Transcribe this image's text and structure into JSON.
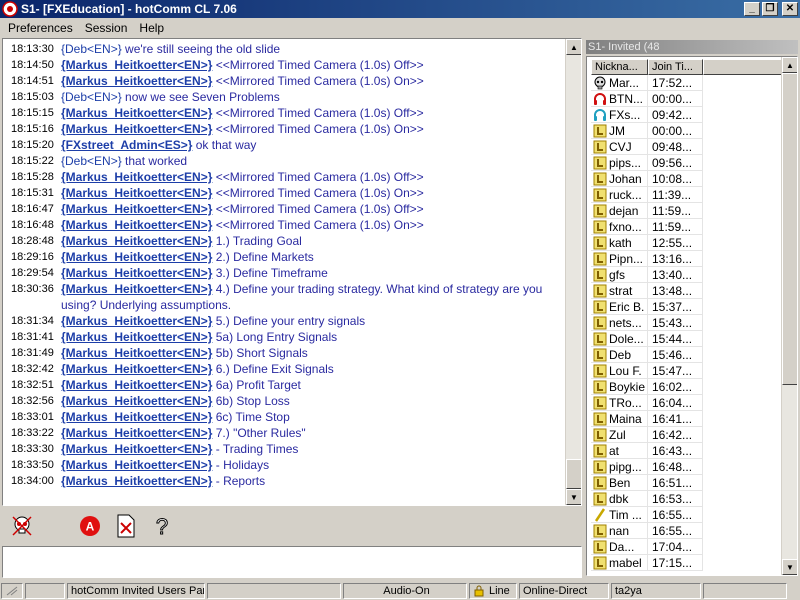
{
  "window": {
    "title": "S1- [FXEducation] - hotComm CL 7.06"
  },
  "menu": [
    "Preferences",
    "Session",
    "Help"
  ],
  "chat": [
    {
      "time": "18:13:30",
      "nick": "{Deb<EN>}",
      "bold": false,
      "msg": " we're still seeing the old slide"
    },
    {
      "time": "18:14:50",
      "nick": "{Markus_Heitkoetter<EN>}",
      "bold": true,
      "msg": " <<Mirrored Timed Camera (1.0s) Off>>"
    },
    {
      "time": "18:14:51",
      "nick": "{Markus_Heitkoetter<EN>}",
      "bold": true,
      "msg": " <<Mirrored Timed Camera (1.0s) On>>"
    },
    {
      "time": "18:15:03",
      "nick": "{Deb<EN>}",
      "bold": false,
      "msg": " now we see Seven Problems"
    },
    {
      "time": "18:15:15",
      "nick": "{Markus_Heitkoetter<EN>}",
      "bold": true,
      "msg": " <<Mirrored Timed Camera (1.0s) Off>>"
    },
    {
      "time": "18:15:16",
      "nick": "{Markus_Heitkoetter<EN>}",
      "bold": true,
      "msg": " <<Mirrored Timed Camera (1.0s) On>>"
    },
    {
      "time": "18:15:20",
      "nick": "{FXstreet_Admin<ES>}",
      "bold": true,
      "msg": " ok that way"
    },
    {
      "time": "18:15:22",
      "nick": "{Deb<EN>}",
      "bold": false,
      "msg": " that worked"
    },
    {
      "time": "18:15:28",
      "nick": "{Markus_Heitkoetter<EN>}",
      "bold": true,
      "msg": " <<Mirrored Timed Camera (1.0s) Off>>"
    },
    {
      "time": "18:15:31",
      "nick": "{Markus_Heitkoetter<EN>}",
      "bold": true,
      "msg": " <<Mirrored Timed Camera (1.0s) On>>"
    },
    {
      "time": "18:16:47",
      "nick": "{Markus_Heitkoetter<EN>}",
      "bold": true,
      "msg": " <<Mirrored Timed Camera (1.0s) Off>>"
    },
    {
      "time": "18:16:48",
      "nick": "{Markus_Heitkoetter<EN>}",
      "bold": true,
      "msg": " <<Mirrored Timed Camera (1.0s) On>>"
    },
    {
      "time": "18:28:48",
      "nick": "{Markus_Heitkoetter<EN>}",
      "bold": true,
      "msg": " 1.) Trading Goal"
    },
    {
      "time": "18:29:16",
      "nick": "{Markus_Heitkoetter<EN>}",
      "bold": true,
      "msg": " 2.) Define Markets"
    },
    {
      "time": "18:29:54",
      "nick": "{Markus_Heitkoetter<EN>}",
      "bold": true,
      "msg": " 3.) Define Timeframe"
    },
    {
      "time": "18:30:36",
      "nick": "{Markus_Heitkoetter<EN>}",
      "bold": true,
      "msg": " 4.) Define your trading strategy. What kind of strategy are you using? Underlying assumptions."
    },
    {
      "time": "18:31:34",
      "nick": "{Markus_Heitkoetter<EN>}",
      "bold": true,
      "msg": " 5.) Define your entry signals"
    },
    {
      "time": "18:31:41",
      "nick": "{Markus_Heitkoetter<EN>}",
      "bold": true,
      "msg": " 5a) Long Entry Signals"
    },
    {
      "time": "18:31:49",
      "nick": "{Markus_Heitkoetter<EN>}",
      "bold": true,
      "msg": " 5b) Short Signals"
    },
    {
      "time": "18:32:42",
      "nick": "{Markus_Heitkoetter<EN>}",
      "bold": true,
      "msg": " 6.) Define Exit Signals"
    },
    {
      "time": "18:32:51",
      "nick": "{Markus_Heitkoetter<EN>}",
      "bold": true,
      "msg": " 6a) Profit Target"
    },
    {
      "time": "18:32:56",
      "nick": "{Markus_Heitkoetter<EN>}",
      "bold": true,
      "msg": " 6b) Stop Loss"
    },
    {
      "time": "18:33:01",
      "nick": "{Markus_Heitkoetter<EN>}",
      "bold": true,
      "msg": " 6c) Time Stop"
    },
    {
      "time": "18:33:22",
      "nick": "{Markus_Heitkoetter<EN>}",
      "bold": true,
      "msg": " 7.) \"Other Rules\""
    },
    {
      "time": "18:33:30",
      "nick": "{Markus_Heitkoetter<EN>}",
      "bold": true,
      "msg": " - Trading Times"
    },
    {
      "time": "18:33:50",
      "nick": "{Markus_Heitkoetter<EN>}",
      "bold": true,
      "msg": " - Holidays"
    },
    {
      "time": "18:34:00",
      "nick": "{Markus_Heitkoetter<EN>}",
      "bold": true,
      "msg": " - Reports"
    }
  ],
  "users_panel": {
    "title": "S1- Invited (48",
    "columns": [
      "Nickna...",
      "Join Ti..."
    ],
    "rows": [
      {
        "nick": "Mar...",
        "time": "17:52...",
        "icon": "host"
      },
      {
        "nick": "BTN...",
        "time": "00:00...",
        "icon": "headset-red"
      },
      {
        "nick": "FXs...",
        "time": "09:42...",
        "icon": "headset-blue"
      },
      {
        "nick": "JM",
        "time": "00:00...",
        "icon": "user"
      },
      {
        "nick": "CVJ",
        "time": "09:48...",
        "icon": "user"
      },
      {
        "nick": "pips...",
        "time": "09:56...",
        "icon": "user"
      },
      {
        "nick": "Johan",
        "time": "10:08...",
        "icon": "user"
      },
      {
        "nick": "ruck...",
        "time": "11:39...",
        "icon": "user"
      },
      {
        "nick": "dejan",
        "time": "11:59...",
        "icon": "user"
      },
      {
        "nick": "fxno...",
        "time": "11:59...",
        "icon": "user"
      },
      {
        "nick": "kath",
        "time": "12:55...",
        "icon": "user"
      },
      {
        "nick": "Pipn...",
        "time": "13:16...",
        "icon": "user"
      },
      {
        "nick": "gfs",
        "time": "13:40...",
        "icon": "user"
      },
      {
        "nick": "strat",
        "time": "13:48...",
        "icon": "user"
      },
      {
        "nick": "Eric B.",
        "time": "15:37...",
        "icon": "user"
      },
      {
        "nick": "nets...",
        "time": "15:43...",
        "icon": "user"
      },
      {
        "nick": "Dole...",
        "time": "15:44...",
        "icon": "user"
      },
      {
        "nick": "Deb",
        "time": "15:46...",
        "icon": "user"
      },
      {
        "nick": "Lou F.",
        "time": "15:47...",
        "icon": "user"
      },
      {
        "nick": "Boykie",
        "time": "16:02...",
        "icon": "user"
      },
      {
        "nick": "TRo...",
        "time": "16:04...",
        "icon": "user"
      },
      {
        "nick": "Maina",
        "time": "16:41...",
        "icon": "user"
      },
      {
        "nick": "Zul",
        "time": "16:42...",
        "icon": "user"
      },
      {
        "nick": "at",
        "time": "16:43...",
        "icon": "user"
      },
      {
        "nick": "pipg...",
        "time": "16:48...",
        "icon": "user"
      },
      {
        "nick": "Ben",
        "time": "16:51...",
        "icon": "user"
      },
      {
        "nick": "dbk",
        "time": "16:53...",
        "icon": "user"
      },
      {
        "nick": "Tim ...",
        "time": "16:55...",
        "icon": "pen"
      },
      {
        "nick": "nan",
        "time": "16:55...",
        "icon": "user"
      },
      {
        "nick": "Da...",
        "time": "17:04...",
        "icon": "user"
      },
      {
        "nick": "mabel",
        "time": "17:15...",
        "icon": "user"
      }
    ]
  },
  "statusbar": {
    "panel": "hotComm Invited Users Pan",
    "audio": "Audio-On",
    "line": "Line",
    "connection": "Online-Direct",
    "user": "ta2ya"
  },
  "colors": {
    "nick": "#1d3ea8",
    "message": "#2a2aa0",
    "title_bar": "#0a246a"
  }
}
